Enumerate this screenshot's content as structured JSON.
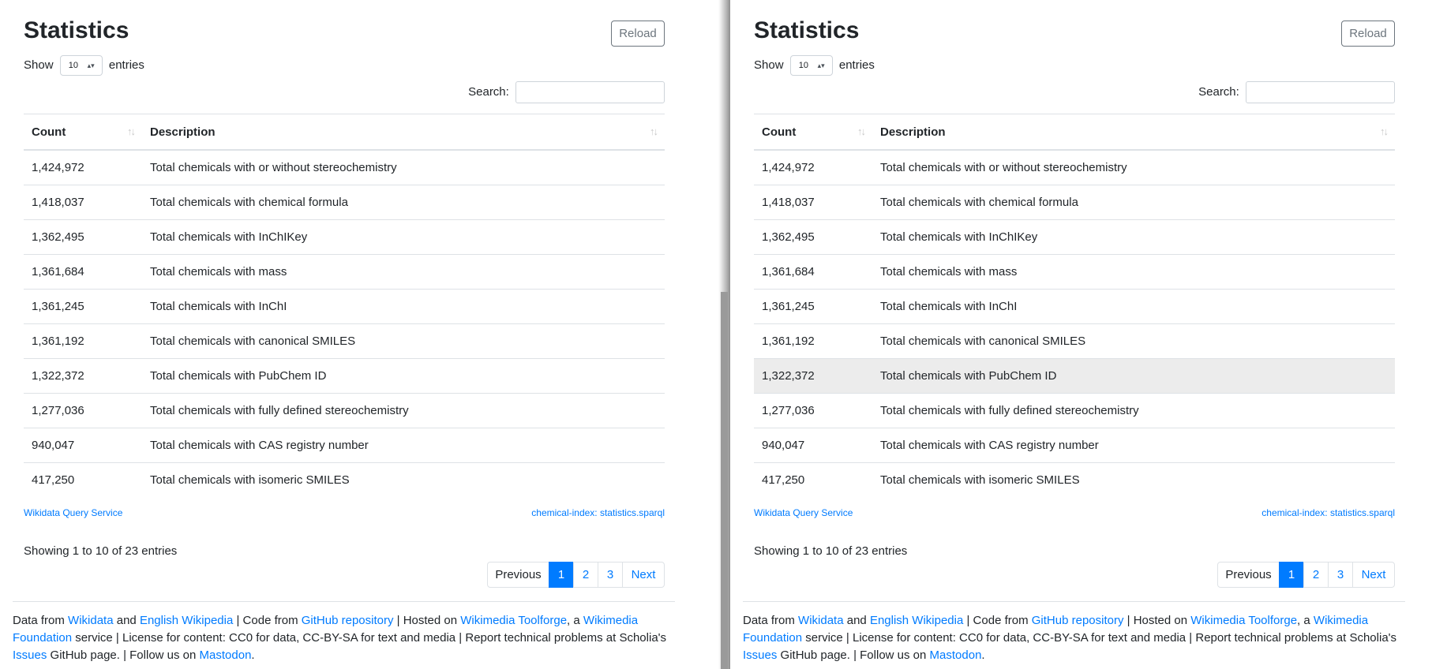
{
  "title": "Statistics",
  "reload_label": "Reload",
  "length": {
    "show": "Show",
    "value": "10",
    "entries": "entries"
  },
  "search_label": "Search:",
  "columns": {
    "count": "Count",
    "description": "Description"
  },
  "rows": [
    {
      "count": "1,424,972",
      "description": "Total chemicals with or without stereochemistry"
    },
    {
      "count": "1,418,037",
      "description": "Total chemicals with chemical formula"
    },
    {
      "count": "1,362,495",
      "description": "Total chemicals with InChIKey"
    },
    {
      "count": "1,361,684",
      "description": "Total chemicals with mass"
    },
    {
      "count": "1,361,245",
      "description": "Total chemicals with InChI"
    },
    {
      "count": "1,361,192",
      "description": "Total chemicals with canonical SMILES"
    },
    {
      "count": "1,322,372",
      "description": "Total chemicals with PubChem ID"
    },
    {
      "count": "1,277,036",
      "description": "Total chemicals with fully defined stereochemistry"
    },
    {
      "count": "940,047",
      "description": "Total chemicals with CAS registry number"
    },
    {
      "count": "417,250",
      "description": "Total chemicals with isomeric SMILES"
    }
  ],
  "links": {
    "wdqs": "Wikidata Query Service",
    "sparql": "chemical-index: statistics.sparql"
  },
  "info": "Showing 1 to 10 of 23 entries",
  "pagination": {
    "previous": "Previous",
    "pages": [
      "1",
      "2",
      "3"
    ],
    "next": "Next"
  },
  "footer": {
    "t1": "Data from ",
    "wikidata": "Wikidata",
    "t2": " and ",
    "wikipedia": "English Wikipedia",
    "t3": " | Code from ",
    "github": "GitHub repository",
    "t4": " | Hosted on ",
    "toolforge": "Wikimedia Toolforge",
    "t5": ", a ",
    "foundation": "Wikimedia Foundation",
    "t6": " service | License for content: CC0 for data, CC-BY-SA for text and media | Report technical problems at Scholia's ",
    "issues": "Issues",
    "t7": " GitHub page. | Follow us on ",
    "mastodon": "Mastodon",
    "t8": "."
  },
  "colors": {
    "accent": "#007bff",
    "hover_row": "#ececec",
    "border": "#dee2e6"
  }
}
